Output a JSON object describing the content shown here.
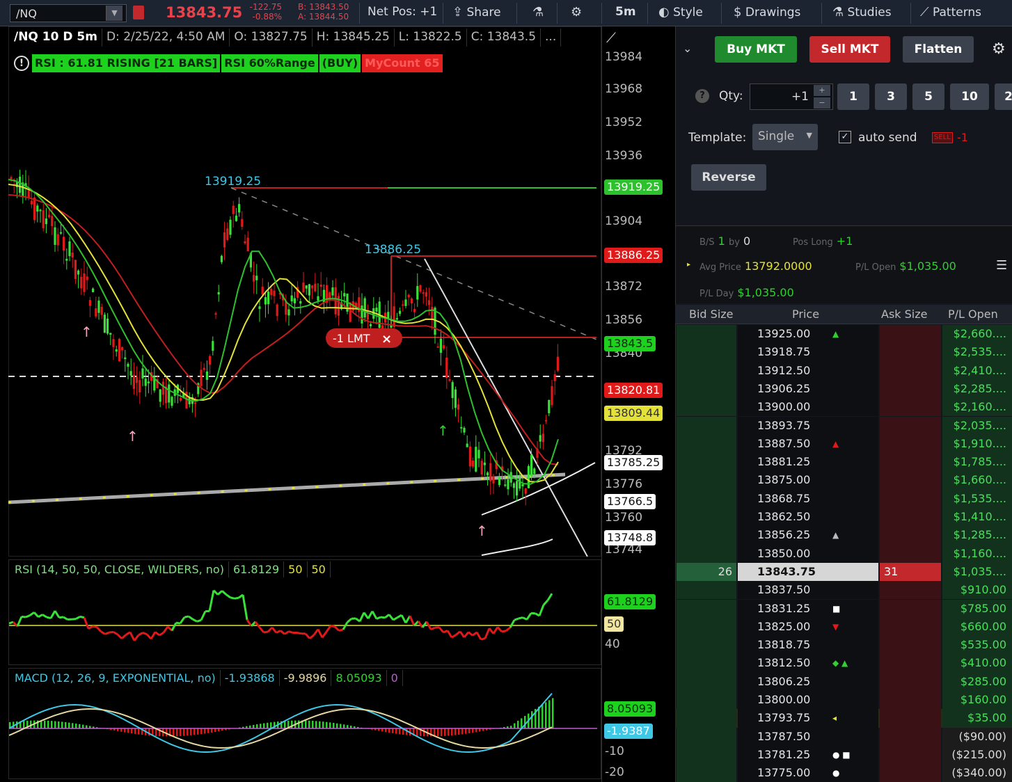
{
  "toolbar": {
    "symbol": "/NQ",
    "last": "13843.75",
    "change": "-122.75",
    "change_pct": "-0.88%",
    "bid": "B: 13843.50",
    "ask": "A: 13844.50",
    "net_pos": "Net Pos: +1",
    "share": "Share",
    "timeframe": "5m",
    "style": "Style",
    "drawings": "Drawings",
    "studies": "Studies",
    "patterns": "Patterns"
  },
  "chart": {
    "header": {
      "symbol": "/NQ 10 D 5m",
      "date": "D: 2/25/22, 4:50 AM",
      "open": "O: 13827.75",
      "high": "H: 13845.25",
      "low": "L: 13822.5",
      "close": "C: 13843.5",
      "more": "..."
    },
    "studies": [
      {
        "label": "RSI : 61.81 RISING [21 BARS]",
        "bg": "#1fd11f",
        "fg": "#0b2a0b"
      },
      {
        "label": "RSI 60%Range",
        "bg": "#1fd11f",
        "fg": "#0b2a0b"
      },
      {
        "label": "(BUY)",
        "bg": "#1fd11f",
        "fg": "#0b2a0b"
      },
      {
        "label": "MyCount 65",
        "bg": "#e32020",
        "fg": "#ff5a5a"
      }
    ],
    "annotations": {
      "high1": "13919.25",
      "high2": "13886.25"
    },
    "order_tag": "-1 LMT",
    "order_close": "×",
    "price_ticks": [
      "13984",
      "13968",
      "13952",
      "13936",
      "13904",
      "13872",
      "13856",
      "13840",
      "13792",
      "13776",
      "13760",
      "13744"
    ],
    "price_labels": {
      "level1": "13919.25",
      "level2": "13886.25",
      "last": "13843.5",
      "ma_red": "13820.81",
      "ma_yellow": "13809.44",
      "l1": "13785.25",
      "l2": "13766.5",
      "l3": "13748.8"
    },
    "colors": {
      "up": "#38e038",
      "down": "#e01919",
      "ema_red": "#c01f1f",
      "ema_yellow": "#e4e23a",
      "ema_green": "#2ec12e"
    }
  },
  "rsi_pane": {
    "title": "RSI (14, 50, 50, CLOSE, WILDERS, no)",
    "value": "61.8129",
    "ob": "50",
    "os": "50",
    "axis_value": "61.8129",
    "axis_mid": "50",
    "axis_low": "40"
  },
  "macd_pane": {
    "title": "MACD (12, 26, 9, EXPONENTIAL, no)",
    "value": "-1.93868",
    "avg": "-9.9896",
    "diff": "8.05093",
    "zero": "0",
    "axis_diff": "8.05093",
    "axis_value": "-1.9387",
    "axis_low": "-10",
    "axis_low2": "-20"
  },
  "trade": {
    "buy": "Buy MKT",
    "sell": "Sell MKT",
    "flatten": "Flatten",
    "qty_label": "Qty:",
    "qty_value": "+1",
    "qty_presets": [
      "1",
      "3",
      "5",
      "10",
      "2"
    ],
    "template_label": "Template:",
    "template_value": "Single",
    "auto_send": "auto send",
    "sell_badge": "SELL",
    "sell_badge_qty": "-1",
    "reverse": "Reverse"
  },
  "position": {
    "bs_label": "B/S",
    "bs_val": "1",
    "by_label": "by",
    "by_val": "0",
    "pos_label": "Pos Long",
    "pos_val": "+1",
    "avg_label": "Avg Price",
    "avg_val": "13792.0000",
    "plopen_label": "P/L Open",
    "plopen_val": "$1,035.00",
    "plday_label": "P/L Day",
    "plday_val": "$1,035.00"
  },
  "ladder": {
    "headers": {
      "bid": "Bid Size",
      "price": "Price",
      "ask": "Ask Size",
      "pl": "P/L Open"
    },
    "rows": [
      {
        "price": "13925.00",
        "bid": "",
        "ask": "",
        "pl": "$2,660....",
        "marker": "▲",
        "mcolor": "#2fd12f"
      },
      {
        "price": "13918.75",
        "bid": "",
        "ask": "",
        "pl": "$2,535....",
        "marker": "",
        "mcolor": ""
      },
      {
        "price": "13912.50",
        "bid": "",
        "ask": "",
        "pl": "$2,410....",
        "marker": "",
        "mcolor": ""
      },
      {
        "price": "13906.25",
        "bid": "",
        "ask": "",
        "pl": "$2,285....",
        "marker": "",
        "mcolor": ""
      },
      {
        "price": "13900.00",
        "bid": "",
        "ask": "",
        "pl": "$2,160....",
        "marker": "",
        "mcolor": ""
      },
      {
        "price": "13893.75",
        "bid": "",
        "ask": "",
        "pl": "$2,035....",
        "marker": "",
        "mcolor": ""
      },
      {
        "price": "13887.50",
        "bid": "",
        "ask": "",
        "pl": "$1,910....",
        "marker": "▲",
        "mcolor": "#e01919"
      },
      {
        "price": "13881.25",
        "bid": "",
        "ask": "",
        "pl": "$1,785....",
        "marker": "",
        "mcolor": ""
      },
      {
        "price": "13875.00",
        "bid": "",
        "ask": "",
        "pl": "$1,660....",
        "marker": "",
        "mcolor": ""
      },
      {
        "price": "13868.75",
        "bid": "",
        "ask": "",
        "pl": "$1,535....",
        "marker": "",
        "mcolor": ""
      },
      {
        "price": "13862.50",
        "bid": "",
        "ask": "",
        "pl": "$1,410....",
        "marker": "",
        "mcolor": ""
      },
      {
        "price": "13856.25",
        "bid": "",
        "ask": "",
        "pl": "$1,285....",
        "marker": "▲",
        "mcolor": "#bbbbbb"
      },
      {
        "price": "13850.00",
        "bid": "",
        "ask": "",
        "pl": "$1,160....",
        "marker": "",
        "mcolor": ""
      },
      {
        "price": "13843.75",
        "bid": "26",
        "ask": "31",
        "pl": "$1,035....",
        "marker": "",
        "mcolor": "",
        "current": true
      },
      {
        "price": "13837.50",
        "bid": "",
        "ask": "",
        "pl": "$910.00",
        "marker": "",
        "mcolor": ""
      },
      {
        "price": "13831.25",
        "bid": "",
        "ask": "",
        "pl": "$785.00",
        "marker": "■",
        "mcolor": "#ffffff"
      },
      {
        "price": "13825.00",
        "bid": "",
        "ask": "",
        "pl": "$660.00",
        "marker": "▼",
        "mcolor": "#e01919"
      },
      {
        "price": "13818.75",
        "bid": "",
        "ask": "",
        "pl": "$535.00",
        "marker": "",
        "mcolor": ""
      },
      {
        "price": "13812.50",
        "bid": "",
        "ask": "",
        "pl": "$410.00",
        "marker": "◆ ▲",
        "mcolor": "#2fd12f"
      },
      {
        "price": "13806.25",
        "bid": "",
        "ask": "",
        "pl": "$285.00",
        "marker": "",
        "mcolor": ""
      },
      {
        "price": "13800.00",
        "bid": "",
        "ask": "",
        "pl": "$160.00",
        "marker": "",
        "mcolor": ""
      },
      {
        "price": "13793.75",
        "bid": "",
        "ask": "",
        "pl": "$35.00",
        "marker": "◂",
        "mcolor": "#e4e23a",
        "avg": true
      },
      {
        "price": "13787.50",
        "bid": "",
        "ask": "",
        "pl": "($90.00)",
        "marker": "",
        "mcolor": "",
        "neg": true
      },
      {
        "price": "13781.25",
        "bid": "",
        "ask": "",
        "pl": "($215.00)",
        "marker": "● ■",
        "mcolor": "#ffffff",
        "neg": true
      },
      {
        "price": "13775.00",
        "bid": "",
        "ask": "",
        "pl": "($340.00)",
        "marker": "●",
        "mcolor": "#ffffff",
        "neg": true
      }
    ]
  }
}
